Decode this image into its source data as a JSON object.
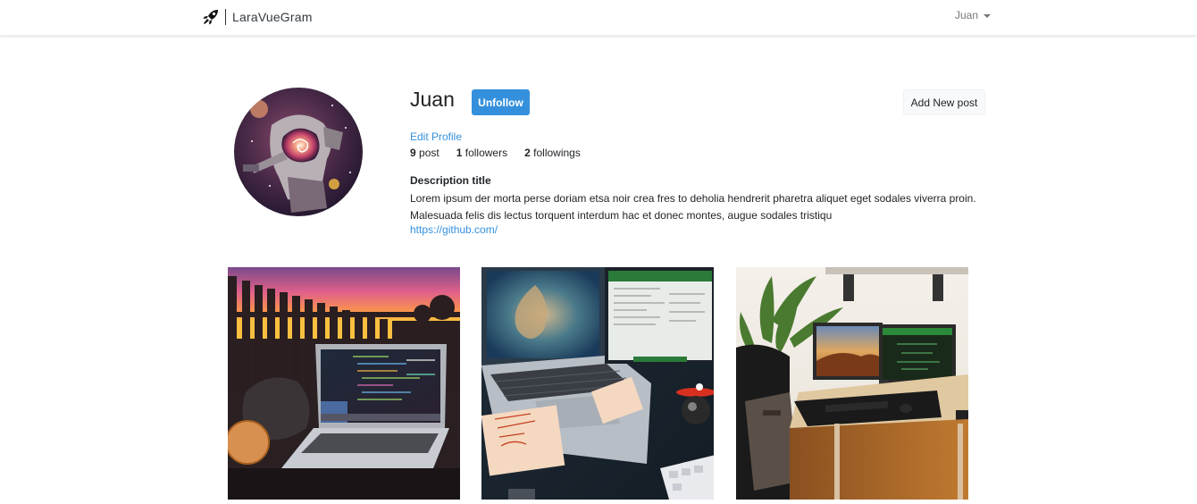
{
  "navbar": {
    "brand": "LaraVueGram",
    "brand_icon": "rocket-icon",
    "user": "Juan"
  },
  "profile": {
    "username": "Juan",
    "unfollow_label": "Unfollow",
    "add_post_label": "Add New post",
    "edit_profile_label": "Edit Profile",
    "stats": {
      "posts_count": "9",
      "posts_label": "post",
      "followers_count": "1",
      "followers_label": "followers",
      "followings_count": "2",
      "followings_label": "followings"
    },
    "description_title": "Description title",
    "description": "Lorem ipsum der morta perse doriam etsa noir crea fres to deholia hendrerit pharetra aliquet eget sodales viverra proin. Malesuada felis dis lectus torquent interdum hac et donec montes, augue sodales tristiqu",
    "website": "https://github.com/"
  },
  "colors": {
    "accent": "#3490dc",
    "button_light": "#f8f9fa"
  }
}
